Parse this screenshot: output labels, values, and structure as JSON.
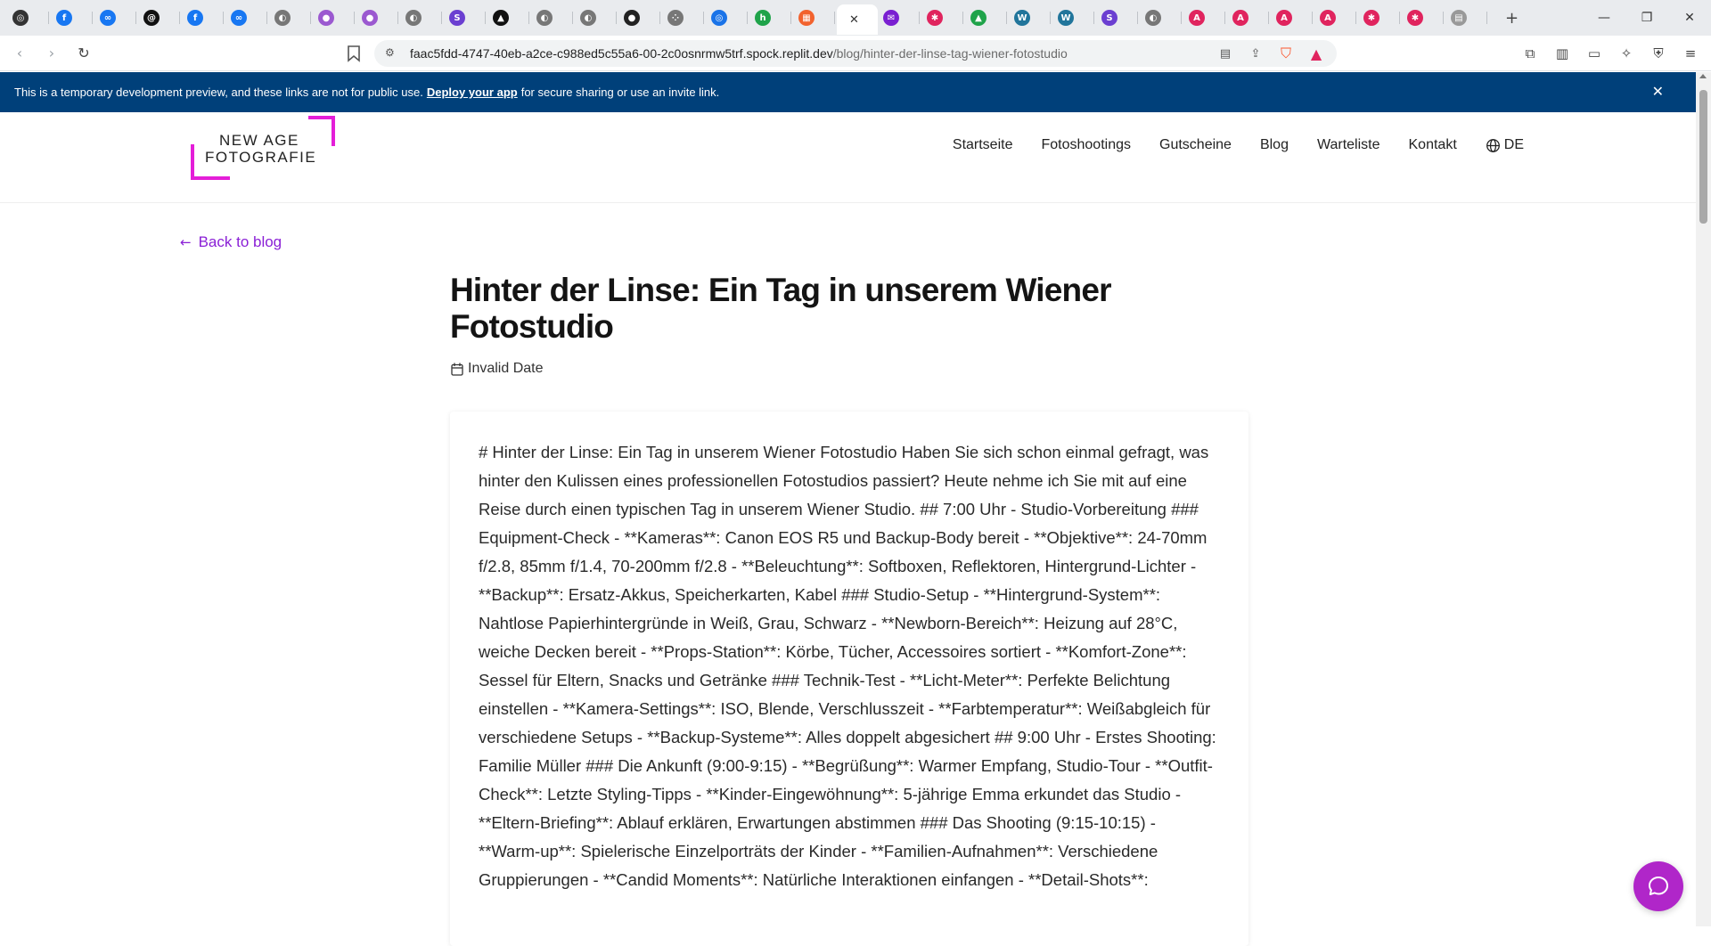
{
  "browser": {
    "tabs": [
      {
        "icon": "circle-icon",
        "color": "#333333",
        "glyph": "◎"
      },
      {
        "icon": "facebook-icon",
        "color": "#1877f2",
        "glyph": "f"
      },
      {
        "icon": "meta-icon",
        "color": "#1877f2",
        "glyph": "∞"
      },
      {
        "icon": "threads-icon",
        "color": "#111111",
        "glyph": "@"
      },
      {
        "icon": "facebook-icon",
        "color": "#1877f2",
        "glyph": "f"
      },
      {
        "icon": "meta-icon",
        "color": "#1877f2",
        "glyph": "∞"
      },
      {
        "icon": "globe-icon",
        "color": "#777777",
        "glyph": "◐"
      },
      {
        "icon": "purple-orb-icon",
        "color": "#9b59d0",
        "glyph": "●"
      },
      {
        "icon": "purple-orb-icon",
        "color": "#9b59d0",
        "glyph": "●"
      },
      {
        "icon": "globe-icon",
        "color": "#777777",
        "glyph": "◐"
      },
      {
        "icon": "s-icon",
        "color": "#6b3fd1",
        "glyph": "S"
      },
      {
        "icon": "triangle-icon",
        "color": "#111111",
        "glyph": "▲"
      },
      {
        "icon": "globe-icon",
        "color": "#777777",
        "glyph": "◐"
      },
      {
        "icon": "globe-icon",
        "color": "#777777",
        "glyph": "◐"
      },
      {
        "icon": "github-icon",
        "color": "#222222",
        "glyph": "●"
      },
      {
        "icon": "dots-icon",
        "color": "#777777",
        "glyph": "⁘"
      },
      {
        "icon": "ring-icon",
        "color": "#1a73e8",
        "glyph": "◎"
      },
      {
        "icon": "green-h-icon",
        "color": "#1fa34a",
        "glyph": "h"
      },
      {
        "icon": "grid-icon",
        "color": "#f2622e",
        "glyph": "▦"
      },
      {
        "icon": "mail-icon",
        "color": "#7a1fd1",
        "glyph": "✉"
      },
      {
        "icon": "asterisk-icon",
        "color": "#e0245e",
        "glyph": "✱"
      },
      {
        "icon": "drive-icon",
        "color": "#1fa34a",
        "glyph": "▲"
      },
      {
        "icon": "wordpress-icon",
        "color": "#21759b",
        "glyph": "W"
      },
      {
        "icon": "wordpress-icon",
        "color": "#21759b",
        "glyph": "W"
      },
      {
        "icon": "s-icon",
        "color": "#6b3fd1",
        "glyph": "S"
      },
      {
        "icon": "globe-icon",
        "color": "#777777",
        "glyph": "◐"
      },
      {
        "icon": "red-a-icon",
        "color": "#e0245e",
        "glyph": "A"
      },
      {
        "icon": "red-a-icon",
        "color": "#e0245e",
        "glyph": "A"
      },
      {
        "icon": "red-a-icon",
        "color": "#e0245e",
        "glyph": "A"
      },
      {
        "icon": "red-a-icon",
        "color": "#e0245e",
        "glyph": "A"
      },
      {
        "icon": "asterisk-icon",
        "color": "#e0245e",
        "glyph": "✱"
      },
      {
        "icon": "asterisk-icon",
        "color": "#e0245e",
        "glyph": "✱"
      },
      {
        "icon": "doc-icon",
        "color": "#999999",
        "glyph": "▤"
      }
    ],
    "url_host": "faac5fdd-4747-40eb-a2ce-c988ed5c55a6-00-2c0osnrmw5trf.spock.replit.dev",
    "url_path": "/blog/hinter-der-linse-tag-wiener-fotostudio"
  },
  "banner": {
    "text_before": "This is a temporary development preview, and these links are not for public use.",
    "link": "Deploy your app",
    "text_after": "for secure sharing or use an invite link."
  },
  "site": {
    "logo_line1": "NEW AGE",
    "logo_line2": "FOTOGRAFIE",
    "brand_color": "#e41ed8",
    "accent_color": "#8a1fd6",
    "nav": [
      "Startseite",
      "Fotoshootings",
      "Gutscheine",
      "Blog",
      "Warteliste",
      "Kontakt"
    ],
    "language": "DE"
  },
  "post": {
    "back_label": "Back to blog",
    "title": "Hinter der Linse: Ein Tag in unserem Wiener Fotostudio",
    "date": "Invalid Date",
    "body": "# Hinter der Linse: Ein Tag in unserem Wiener Fotostudio Haben Sie sich schon einmal gefragt, was hinter den Kulissen eines professionellen Fotostudios passiert? Heute nehme ich Sie mit auf eine Reise durch einen typischen Tag in unserem Wiener Studio. ## 7:00 Uhr - Studio-Vorbereitung ### Equipment-Check - **Kameras**: Canon EOS R5 und Backup-Body bereit - **Objektive**: 24-70mm f/2.8, 85mm f/1.4, 70-200mm f/2.8 - **Beleuchtung**: Softboxen, Reflektoren, Hintergrund-Lichter - **Backup**: Ersatz-Akkus, Speicherkarten, Kabel ### Studio-Setup - **Hintergrund-System**: Nahtlose Papierhintergründe in Weiß, Grau, Schwarz - **Newborn-Bereich**: Heizung auf 28°C, weiche Decken bereit - **Props-Station**: Körbe, Tücher, Accessoires sortiert - **Komfort-Zone**: Sessel für Eltern, Snacks und Getränke ### Technik-Test - **Licht-Meter**: Perfekte Belichtung einstellen - **Kamera-Settings**: ISO, Blende, Verschlusszeit - **Farbtemperatur**: Weißabgleich für verschiedene Setups - **Backup-Systeme**: Alles doppelt abgesichert ## 9:00 Uhr - Erstes Shooting: Familie Müller ### Die Ankunft (9:00-9:15) - **Begrüßung**: Warmer Empfang, Studio-Tour - **Outfit-Check**: Letzte Styling-Tipps - **Kinder-Eingewöhnung**: 5-jährige Emma erkundet das Studio - **Eltern-Briefing**: Ablauf erklären, Erwartungen abstimmen ### Das Shooting (9:15-10:15) - **Warm-up**: Spielerische Einzelporträts der Kinder - **Familien-Aufnahmen**: Verschiedene Gruppierungen - **Candid Moments**: Natürliche Interaktionen einfangen - **Detail-Shots**:"
  }
}
